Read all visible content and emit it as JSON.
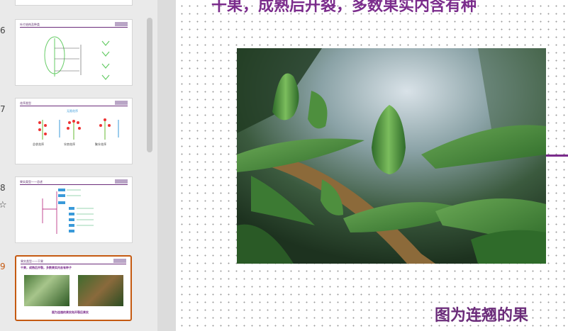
{
  "thumbnails": [
    {
      "number": "6",
      "title": "叶片结构及种类",
      "active": false
    },
    {
      "number": "7",
      "title": "花序类型",
      "active": false,
      "subtitle": "无限花序",
      "labels": [
        "总状花序",
        "伞房花序",
        "聚伞花序"
      ]
    },
    {
      "number": "8",
      "title": "果实类型——总述",
      "active": false
    },
    {
      "number": "9",
      "title": "果实类型——干果",
      "active": true,
      "subtitle": "干果，成熟后开裂，多数果实内含有种子",
      "caption": "图为连翘的果实和开裂后果实"
    }
  ],
  "slide": {
    "title": "干果，成熟后开裂，多数果实内含有种",
    "caption": "图为连翘的果"
  },
  "colors": {
    "accent": "#7b2c8c",
    "active_thumb": "#c55a11"
  }
}
